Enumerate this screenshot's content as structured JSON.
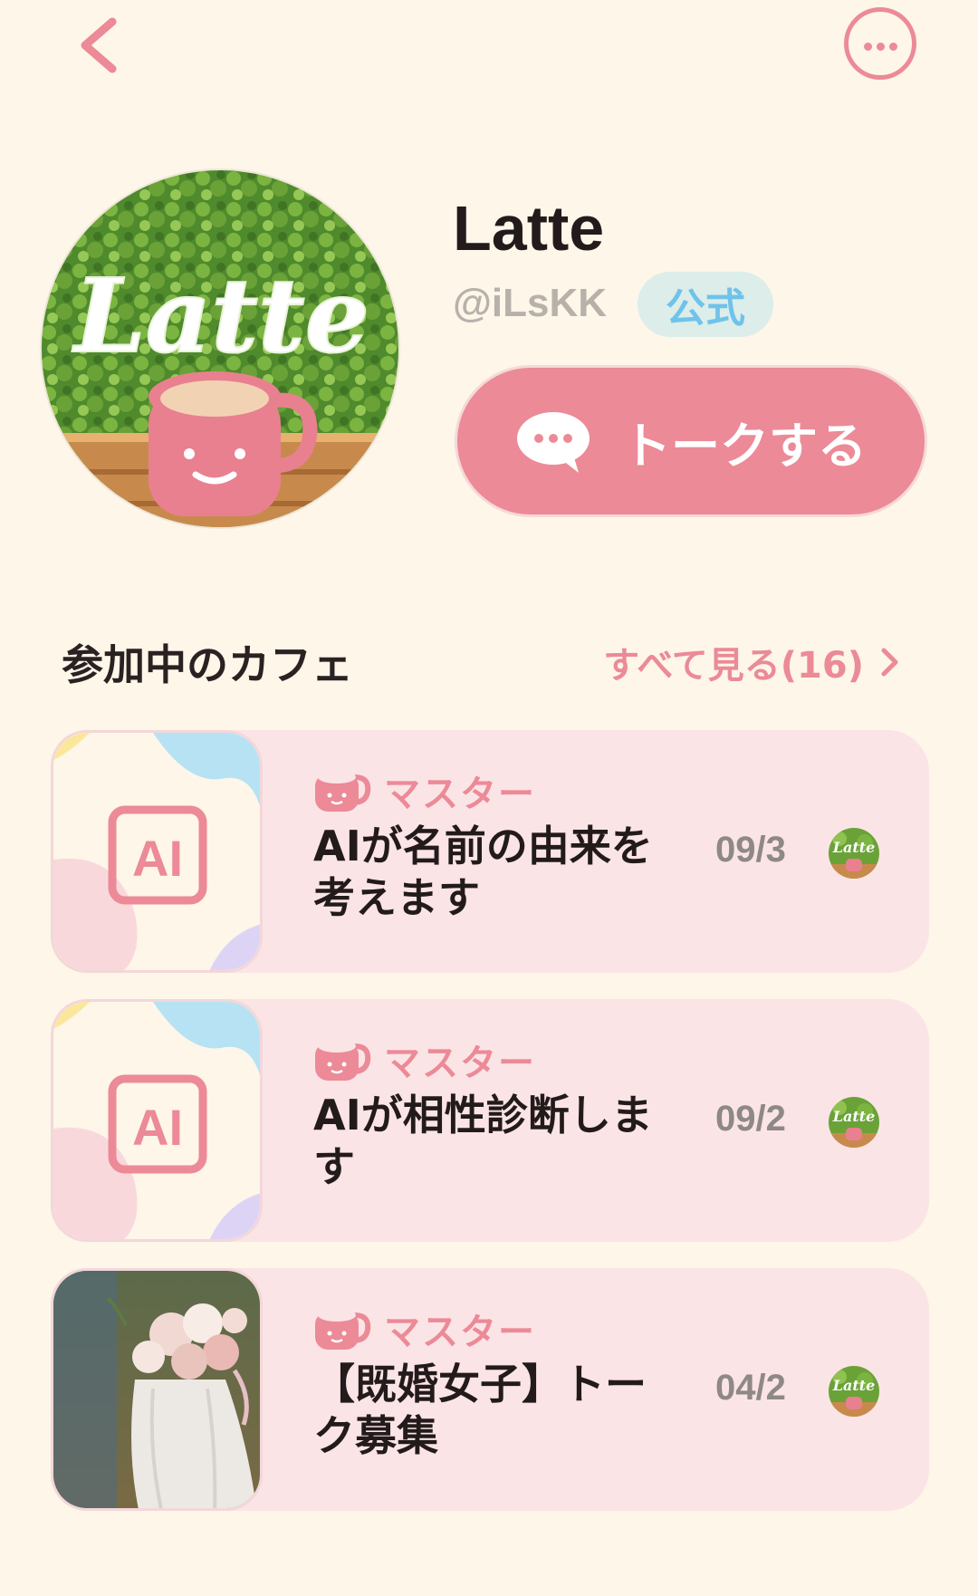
{
  "header": {
    "back_icon": "chevron-left-icon",
    "more_icon": "more-horizontal-icon"
  },
  "profile": {
    "avatar_logo_text": "Latte",
    "name": "Latte",
    "handle": "@iLsKK",
    "badge": "公式",
    "talk_button": "トークする",
    "talk_icon": "chat-bubble-icon"
  },
  "section": {
    "title": "参加中のカフェ",
    "see_all": "すべて見る(16)"
  },
  "cafes": [
    {
      "role": "マスター",
      "title": "AIが名前の由来を考えます",
      "date": "09/3",
      "thumb": "AI"
    },
    {
      "role": "マスター",
      "title": "AIが相性診断します",
      "date": "09/2",
      "thumb": "AI"
    },
    {
      "role": "マスター",
      "title": "【既婚女子】トーク募集",
      "date": "04/2",
      "thumb": "wedding-photo"
    }
  ],
  "colors": {
    "background": "#fdf6e9",
    "accent": "#ec8a97",
    "card": "#fbe4e6",
    "badge_bg": "#dcedea",
    "badge_text": "#6fc3ea"
  }
}
